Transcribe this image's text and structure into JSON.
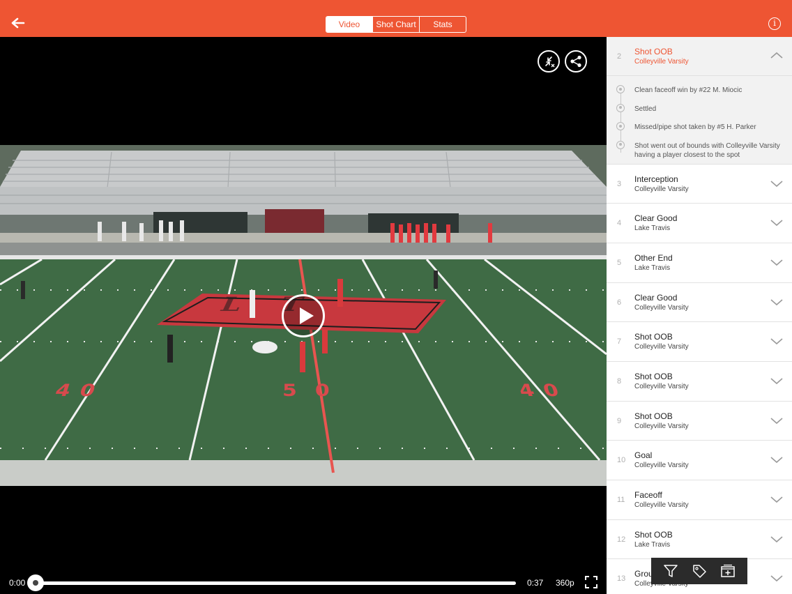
{
  "header": {
    "tabs": [
      {
        "label": "Video",
        "active": true
      },
      {
        "label": "Shot Chart",
        "active": false
      },
      {
        "label": "Stats",
        "active": false
      }
    ],
    "info_label": "i"
  },
  "player": {
    "current_time": "0:00",
    "duration": "0:37",
    "quality": "360p",
    "progress": 0
  },
  "field": {
    "yard_left": "40",
    "yard_center": "50",
    "yard_right": "40",
    "logo": "LT"
  },
  "sidebar": {
    "expanded": {
      "number": "2",
      "title": "Shot OOB",
      "team": "Colleyville Varsity",
      "events": [
        "Clean faceoff win by #22 M. Miocic",
        "Settled",
        "Missed/pipe shot taken by #5 H. Parker",
        "Shot went out of bounds with Colleyville Varsity having a player closest to the spot"
      ]
    },
    "items": [
      {
        "number": "3",
        "title": "Interception",
        "team": "Colleyville Varsity"
      },
      {
        "number": "4",
        "title": "Clear Good",
        "team": "Lake Travis"
      },
      {
        "number": "5",
        "title": "Other End",
        "team": "Lake Travis"
      },
      {
        "number": "6",
        "title": "Clear Good",
        "team": "Colleyville Varsity"
      },
      {
        "number": "7",
        "title": "Shot OOB",
        "team": "Colleyville Varsity"
      },
      {
        "number": "8",
        "title": "Shot OOB",
        "team": "Colleyville Varsity"
      },
      {
        "number": "9",
        "title": "Shot OOB",
        "team": "Colleyville Varsity"
      },
      {
        "number": "10",
        "title": "Goal",
        "team": "Colleyville Varsity"
      },
      {
        "number": "11",
        "title": "Faceoff",
        "team": "Colleyville Varsity"
      },
      {
        "number": "12",
        "title": "Shot OOB",
        "team": "Lake Travis"
      },
      {
        "number": "13",
        "title": "Grou",
        "team": "Colleyville Varsity"
      }
    ]
  },
  "colors": {
    "accent": "#EE5533",
    "turf": "#3F6B45"
  },
  "icons": {
    "back": "arrow-left-icon",
    "collapse": "collapse-arrows-icon",
    "share": "share-icon",
    "play": "play-icon",
    "fullscreen": "fullscreen-icon",
    "filter": "filter-icon",
    "tag": "tag-icon",
    "clip": "add-clip-icon"
  }
}
